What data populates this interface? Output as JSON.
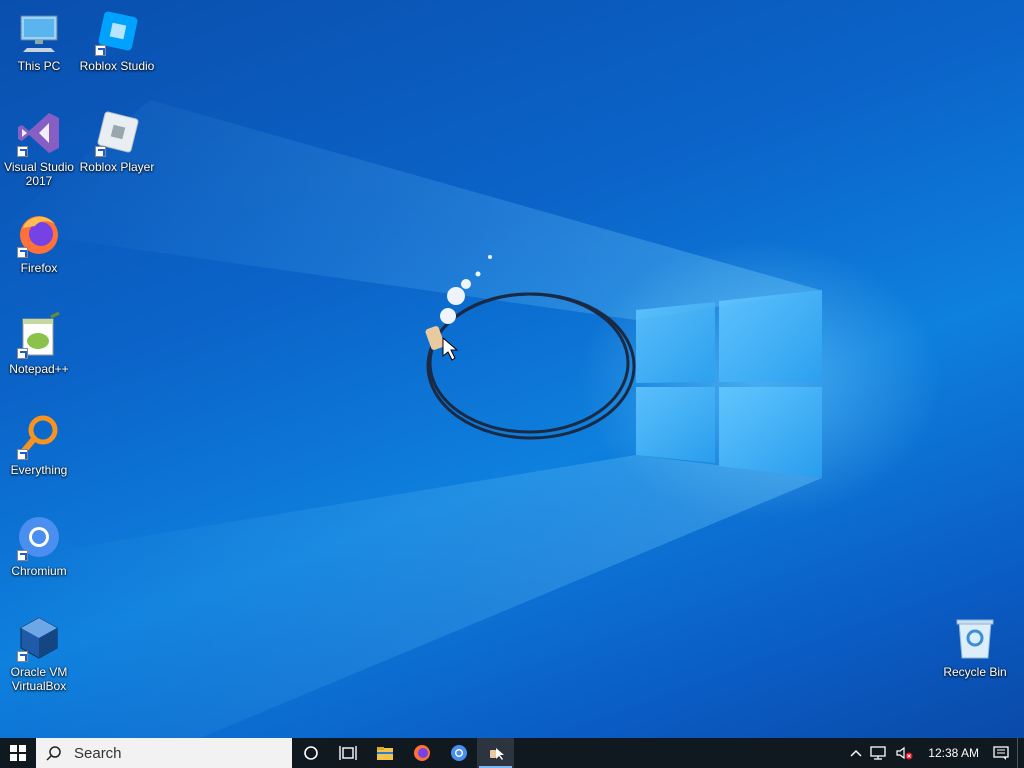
{
  "desktop": {
    "icons": [
      {
        "label": "This PC",
        "icon": "computer-icon"
      },
      {
        "label": "Roblox Studio",
        "icon": "roblox-studio-icon"
      },
      {
        "label": "Visual Studio 2017",
        "icon": "visual-studio-icon"
      },
      {
        "label": "Roblox Player",
        "icon": "roblox-player-icon"
      },
      {
        "label": "Firefox",
        "icon": "firefox-icon"
      },
      {
        "label": "Notepad++",
        "icon": "notepad-plus-plus-icon"
      },
      {
        "label": "Everything",
        "icon": "everything-search-icon"
      },
      {
        "label": "Chromium",
        "icon": "chromium-icon"
      },
      {
        "label": "Oracle VM VirtualBox",
        "icon": "virtualbox-icon"
      },
      {
        "label": "Recycle Bin",
        "icon": "recycle-bin-icon"
      }
    ]
  },
  "taskbar": {
    "search_placeholder": "Search",
    "pinned": [
      "cortana-icon",
      "task-view-icon",
      "file-explorer-icon",
      "firefox-icon",
      "chromium-icon",
      "running-app-icon"
    ],
    "clock": "12:38 AM"
  },
  "colors": {
    "taskbar": "#101820",
    "wallpaper": "#0b63c8",
    "accent": "#7ab8f5"
  }
}
